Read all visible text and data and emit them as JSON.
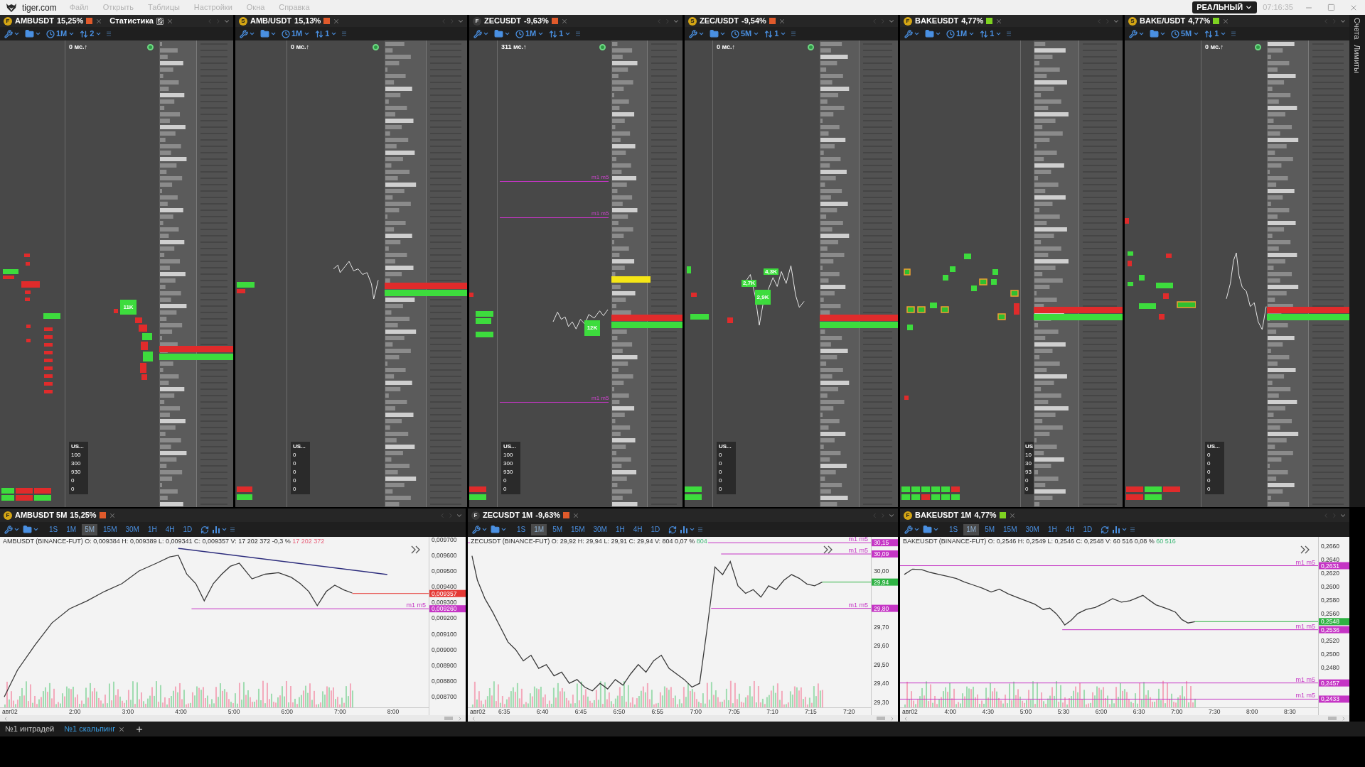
{
  "title_bar": {
    "app_name": "tiger.com",
    "menu": [
      "Файл",
      "Открыть",
      "Таблицы",
      "Настройки",
      "Окна",
      "Справка"
    ],
    "account_mode": "РЕАЛЬНЫЙ",
    "time": "07:16:35"
  },
  "panels": [
    {
      "tabs": [
        {
          "kind": "market",
          "badge": {
            "kind": "circle",
            "letter": "F"
          },
          "symbol": "AMBUSDT",
          "change": "15,25%",
          "color": "#e05a2b"
        },
        {
          "kind": "stats",
          "label": "Статистика"
        }
      ],
      "toolbar": {
        "interval": "1M",
        "depth": "2"
      },
      "latency": "0 мс.↑",
      "summary": {
        "title": "US...",
        "values": [
          "100",
          "300",
          "930",
          "0",
          "0"
        ]
      },
      "clusters": [
        {
          "label": "11K"
        }
      ]
    },
    {
      "tabs": [
        {
          "kind": "market",
          "badge": {
            "kind": "circle",
            "letter": "S"
          },
          "symbol": "AMB/USDT",
          "change": "15,13%",
          "color": "#e05a2b"
        }
      ],
      "toolbar": {
        "interval": "1M",
        "depth": "1"
      },
      "latency": "0 мс.↑",
      "summary": {
        "title": "US...",
        "values": [
          "0",
          "0",
          "0",
          "0",
          "0"
        ]
      }
    },
    {
      "tabs": [
        {
          "kind": "market",
          "badge": {
            "kind": "plain",
            "letter": "F"
          },
          "symbol": "ZECUSDT",
          "change": "-9,63%",
          "color": "#e05a2b"
        }
      ],
      "toolbar": {
        "interval": "1M",
        "depth": "1"
      },
      "latency": "311 мс.↑",
      "summary": {
        "title": "US...",
        "values": [
          "100",
          "300",
          "930",
          "0",
          "0"
        ]
      },
      "clusters": [
        {
          "label": "12K"
        }
      ],
      "levels": [
        {
          "label": "m1 m5"
        },
        {
          "label": "m1 m5"
        },
        {
          "label": "m1 m5"
        }
      ]
    },
    {
      "tabs": [
        {
          "kind": "market",
          "badge": {
            "kind": "circle",
            "letter": "S"
          },
          "symbol": "ZEC/USDT",
          "change": "-9,54%",
          "color": "#e05a2b"
        }
      ],
      "toolbar": {
        "interval": "5M",
        "depth": "1"
      },
      "latency": "0 мс.↑",
      "summary": {
        "title": "US...",
        "values": [
          "0",
          "0",
          "0",
          "0",
          "0"
        ]
      },
      "clusters": [
        {
          "label": "2,7K"
        },
        {
          "label": "4,3K"
        },
        {
          "label": "2,9K"
        }
      ]
    },
    {
      "tabs": [
        {
          "kind": "market",
          "badge": {
            "kind": "circle",
            "letter": "F"
          },
          "symbol": "BAKEUSDT",
          "change": "4,77%",
          "color": "#7ed321"
        }
      ],
      "toolbar": {
        "interval": "1M",
        "depth": "1"
      },
      "summary": {
        "title": "US",
        "values": [
          "10",
          "30",
          "93",
          "0",
          "0"
        ]
      }
    },
    {
      "tabs": [
        {
          "kind": "market",
          "badge": {
            "kind": "circle",
            "letter": "S"
          },
          "symbol": "BAKE/USDT",
          "change": "4,77%",
          "color": "#7ed321"
        }
      ],
      "toolbar": {
        "interval": "5M",
        "depth": "1"
      },
      "latency": "0 мс.↑",
      "summary": {
        "title": "US...",
        "values": [
          "0",
          "0",
          "0",
          "0",
          "0"
        ]
      }
    }
  ],
  "side_tabs": [
    "Счета",
    "Лимиты"
  ],
  "charts": [
    {
      "tab": {
        "badge": {
          "kind": "circle",
          "letter": "F"
        },
        "title": "AMBUSDT 5M",
        "change": "15,25%",
        "color": "#e05a2b"
      },
      "intervals": [
        {
          "label": "1S",
          "selected": false
        },
        {
          "label": "1M",
          "selected": false
        },
        {
          "label": "5M",
          "selected": true
        },
        {
          "label": "15M",
          "selected": false
        },
        {
          "label": "30M",
          "selected": false
        },
        {
          "label": "1H",
          "selected": false
        },
        {
          "label": "4H",
          "selected": false
        },
        {
          "label": "1D",
          "selected": false
        }
      ],
      "info": {
        "text": "AMBUSDT (BINANCE-FUT) O: 0,009384 H: 0,009389 L: 0,009341 C: 0,009357 V: 17 202 372 -0,3 %",
        "volume": {
          "text": "17 202 372",
          "kind": "fall"
        }
      },
      "date_label": "авг02",
      "chart_data": {
        "type": "line",
        "x": [
          0.67,
          0.92,
          1.25,
          1.57,
          1.9,
          2.23,
          2.56,
          2.89,
          3.21,
          3.54,
          3.79,
          3.95,
          4.11,
          4.28,
          4.44,
          4.61,
          4.77,
          4.93,
          5.1,
          5.34,
          5.59,
          5.84,
          6.08,
          6.25,
          6.41,
          6.57,
          6.74,
          6.9,
          7.07,
          7.23
        ],
        "xlim": [
          0.59,
          8.67
        ],
        "ylim": [
          0.008633,
          0.009717
        ],
        "xticks": [
          {
            "value": 2,
            "label": "2:00"
          },
          {
            "value": 3,
            "label": "3:00"
          },
          {
            "value": 4,
            "label": "4:00"
          },
          {
            "value": 5,
            "label": "5:00"
          },
          {
            "value": 6,
            "label": "6:00"
          },
          {
            "value": 7,
            "label": "7:00"
          },
          {
            "value": 8,
            "label": "8:00"
          }
        ],
        "yticks": [
          {
            "value": 0.0097,
            "label": "0,009700"
          },
          {
            "value": 0.0096,
            "label": "0,009600"
          },
          {
            "value": 0.0095,
            "label": "0,009500"
          },
          {
            "value": 0.0094,
            "label": "0,009400"
          },
          {
            "value": 0.0093,
            "label": "0,009300"
          },
          {
            "value": 0.0092,
            "label": "0,009200"
          },
          {
            "value": 0.0091,
            "label": "0,009100"
          },
          {
            "value": 0.009,
            "label": "0,009000"
          },
          {
            "value": 0.0089,
            "label": "0,008900"
          },
          {
            "value": 0.0088,
            "label": "0,008800"
          },
          {
            "value": 0.0087,
            "label": "0,008700"
          }
        ],
        "series": [
          {
            "color": "#3a3a3a",
            "values": [
              0.0087,
              0.00887,
              0.00903,
              0.00917,
              0.00926,
              0.00931,
              0.00937,
              0.00942,
              0.0095,
              0.00955,
              0.00959,
              0.0096,
              0.00948,
              0.00942,
              0.00931,
              0.00942,
              0.00948,
              0.00953,
              0.00955,
              0.00945,
              0.00948,
              0.00949,
              0.00946,
              0.00942,
              0.00937,
              0.00928,
              0.00937,
              0.00941,
              0.00938,
              0.00936
            ]
          }
        ],
        "ref_lines": [
          {
            "axis": "y",
            "value": 0.009357,
            "color": "#e53935"
          },
          {
            "axis": "y",
            "value": 0.00926,
            "label": "m1 m5",
            "color": "#c535c5"
          }
        ]
      },
      "price_tags": [
        {
          "label": "0,009357"
        },
        {
          "label": "0,009260"
        }
      ]
    },
    {
      "tab": {
        "badge": {
          "kind": "plain",
          "letter": "F"
        },
        "title": "ZECUSDT 1M",
        "change": "-9,63%",
        "color": "#e05a2b"
      },
      "intervals": [
        {
          "label": "1S",
          "selected": false
        },
        {
          "label": "1M",
          "selected": true
        },
        {
          "label": "5M",
          "selected": false
        },
        {
          "label": "15M",
          "selected": false
        },
        {
          "label": "30M",
          "selected": false
        },
        {
          "label": "1H",
          "selected": false
        },
        {
          "label": "4H",
          "selected": false
        },
        {
          "label": "1D",
          "selected": false
        }
      ],
      "info": {
        "text": "ZECUSDT (BINANCE-FUT) O: 29,92 H: 29,94 L: 29,91 C: 29,94 V: 804 0,07 %",
        "volume": {
          "text": "804",
          "kind": "rise"
        }
      },
      "date_label": "авг02",
      "chart_data": {
        "type": "line",
        "x": [
          6.5133,
          6.525,
          6.5417,
          6.5583,
          6.575,
          6.5917,
          6.6083,
          6.625,
          6.6417,
          6.6583,
          6.675,
          6.6917,
          6.7083,
          6.725,
          6.7417,
          6.7583,
          6.775,
          6.7917,
          6.8083,
          6.825,
          6.8417,
          6.8583,
          6.875,
          6.8917,
          6.9083,
          6.925,
          6.9417,
          6.9583,
          6.975,
          6.9917,
          7.0083,
          7.025,
          7.0417,
          7.0583,
          7.075,
          7.0917,
          7.1083,
          7.125,
          7.1417,
          7.1583,
          7.175,
          7.1917,
          7.2083,
          7.225,
          7.2417,
          7.2583,
          7.275
        ],
        "xlim": [
          6.5042,
          7.3808
        ],
        "ylim": [
          29.272,
          30.181
        ],
        "xticks": [
          {
            "value": 6.5833,
            "label": "6:35"
          },
          {
            "value": 6.6667,
            "label": "6:40"
          },
          {
            "value": 6.75,
            "label": "6:45"
          },
          {
            "value": 6.8333,
            "label": "6:50"
          },
          {
            "value": 6.9167,
            "label": "6:55"
          },
          {
            "value": 7,
            "label": "7:00"
          },
          {
            "value": 7.0833,
            "label": "7:05"
          },
          {
            "value": 7.1667,
            "label": "7:10"
          },
          {
            "value": 7.25,
            "label": "7:15"
          },
          {
            "value": 7.3333,
            "label": "7:20"
          }
        ],
        "yticks": [
          {
            "value": 30,
            "label": "30,00"
          },
          {
            "value": 29.7,
            "label": "29,70"
          },
          {
            "value": 29.6,
            "label": "29,60"
          },
          {
            "value": 29.5,
            "label": "29,50"
          },
          {
            "value": 29.4,
            "label": "29,40"
          },
          {
            "value": 29.3,
            "label": "29,30"
          }
        ],
        "series": [
          {
            "color": "#3a3a3a",
            "values": [
              30.08,
              29.95,
              29.85,
              29.78,
              29.7,
              29.62,
              29.58,
              29.52,
              29.55,
              29.48,
              29.5,
              29.44,
              29.46,
              29.4,
              29.42,
              29.38,
              29.36,
              29.4,
              29.37,
              29.42,
              29.39,
              29.45,
              29.5,
              29.46,
              29.52,
              29.55,
              29.48,
              29.45,
              29.42,
              29.38,
              29.4,
              29.7,
              30.02,
              29.98,
              30.05,
              29.92,
              29.88,
              29.9,
              29.86,
              29.92,
              29.9,
              29.95,
              29.98,
              29.96,
              29.93,
              29.92,
              29.94
            ]
          }
        ],
        "ref_lines": [
          {
            "axis": "y",
            "value": 30.15,
            "label": "m1 m5",
            "color": "#c535c5"
          },
          {
            "axis": "y",
            "value": 30.09,
            "label": "m1 m5",
            "color": "#c535c5"
          },
          {
            "axis": "y",
            "value": 29.94,
            "color": "#2fb344"
          },
          {
            "axis": "y",
            "value": 29.8,
            "label": "m1 m5",
            "color": "#c535c5"
          }
        ]
      },
      "price_tags": [
        {
          "label": "30,15"
        },
        {
          "label": "30,09"
        },
        {
          "label": "29,94"
        },
        {
          "label": "29,80"
        }
      ]
    },
    {
      "tab": {
        "badge": {
          "kind": "circle",
          "letter": "F"
        },
        "title": "BAKEUSDT 1M",
        "change": "4,77%",
        "color": "#7ed321"
      },
      "intervals": [
        {
          "label": "1S",
          "selected": false
        },
        {
          "label": "1M",
          "selected": true
        },
        {
          "label": "5M",
          "selected": false
        },
        {
          "label": "15M",
          "selected": false
        },
        {
          "label": "30M",
          "selected": false
        },
        {
          "label": "1H",
          "selected": false
        },
        {
          "label": "4H",
          "selected": false
        },
        {
          "label": "1D",
          "selected": false
        }
      ],
      "info": {
        "text": "BAKEUSDT (BINANCE-FUT) O: 0,2546 H: 0,2549 L: 0,2546 C: 0,2548 V: 60 516 0,08 %",
        "volume": {
          "text": "60 516",
          "kind": "rise"
        }
      },
      "date_label": "авг02",
      "chart_data": {
        "type": "line",
        "x": [
          3.39,
          3.5,
          3.62,
          3.7333,
          3.85,
          3.9667,
          4.08,
          4.1833,
          4.31,
          4.4167,
          4.54,
          4.65,
          4.77,
          4.8833,
          5,
          5.1167,
          5.23,
          5.3167,
          5.4017,
          5.4667,
          5.5167,
          5.6,
          5.69,
          5.8,
          5.92,
          6.0333,
          6.15,
          6.2667,
          6.38,
          6.4667,
          6.5517,
          6.6333,
          6.7233,
          6.8,
          6.8967,
          6.9833,
          7.0683,
          7.15,
          7.2417
        ],
        "xlim": [
          3.3333,
          8.8733
        ],
        "ylim": [
          0.24208,
          0.26737
        ],
        "xticks": [
          {
            "value": 4,
            "label": "4:00"
          },
          {
            "value": 4.5,
            "label": "4:30"
          },
          {
            "value": 5,
            "label": "5:00"
          },
          {
            "value": 5.5,
            "label": "5:30"
          },
          {
            "value": 6,
            "label": "6:00"
          },
          {
            "value": 6.5,
            "label": "6:30"
          },
          {
            "value": 7,
            "label": "7:00"
          },
          {
            "value": 7.5,
            "label": "7:30"
          },
          {
            "value": 8,
            "label": "8:00"
          },
          {
            "value": 8.5,
            "label": "8:30"
          }
        ],
        "yticks": [
          {
            "value": 0.266,
            "label": "0,2660"
          },
          {
            "value": 0.264,
            "label": "0,2640"
          },
          {
            "value": 0.262,
            "label": "0,2620"
          },
          {
            "value": 0.26,
            "label": "0,2600"
          },
          {
            "value": 0.258,
            "label": "0,2580"
          },
          {
            "value": 0.256,
            "label": "0,2560"
          },
          {
            "value": 0.252,
            "label": "0,2520"
          },
          {
            "value": 0.25,
            "label": "0,2500"
          },
          {
            "value": 0.248,
            "label": "0,2480"
          }
        ],
        "series": [
          {
            "color": "#3a3a3a",
            "values": [
              0.2618,
              0.2626,
              0.2625,
              0.2621,
              0.2618,
              0.2615,
              0.2612,
              0.2607,
              0.2602,
              0.2598,
              0.2592,
              0.2596,
              0.2589,
              0.2584,
              0.2579,
              0.2574,
              0.2566,
              0.2568,
              0.256,
              0.2551,
              0.2543,
              0.255,
              0.256,
              0.2566,
              0.2569,
              0.2575,
              0.2582,
              0.2577,
              0.2579,
              0.2583,
              0.2587,
              0.258,
              0.2573,
              0.257,
              0.2566,
              0.2562,
              0.2551,
              0.2546,
              0.2548
            ]
          }
        ],
        "ref_lines": [
          {
            "axis": "y",
            "value": 0.2631,
            "label": "m1 m5",
            "color": "#c535c5"
          },
          {
            "axis": "y",
            "value": 0.2548,
            "color": "#2fb344"
          },
          {
            "axis": "y",
            "value": 0.2536,
            "label": "m1 m5",
            "color": "#c535c5"
          },
          {
            "axis": "y",
            "value": 0.2457,
            "label": "m1 m5",
            "color": "#c535c5"
          },
          {
            "axis": "y",
            "value": 0.2433,
            "label": "m1 m5",
            "color": "#c535c5"
          }
        ]
      },
      "price_tags": [
        {
          "label": "0,2631"
        },
        {
          "label": "0,2548"
        },
        {
          "label": "0,2536"
        },
        {
          "label": "0,2457"
        },
        {
          "label": "0,2433"
        }
      ]
    }
  ],
  "workspace_tabs": [
    {
      "label": "№1 интрадей",
      "selected": false,
      "closable": false
    },
    {
      "label": "№1 скальпинг",
      "selected": true,
      "closable": true
    }
  ]
}
